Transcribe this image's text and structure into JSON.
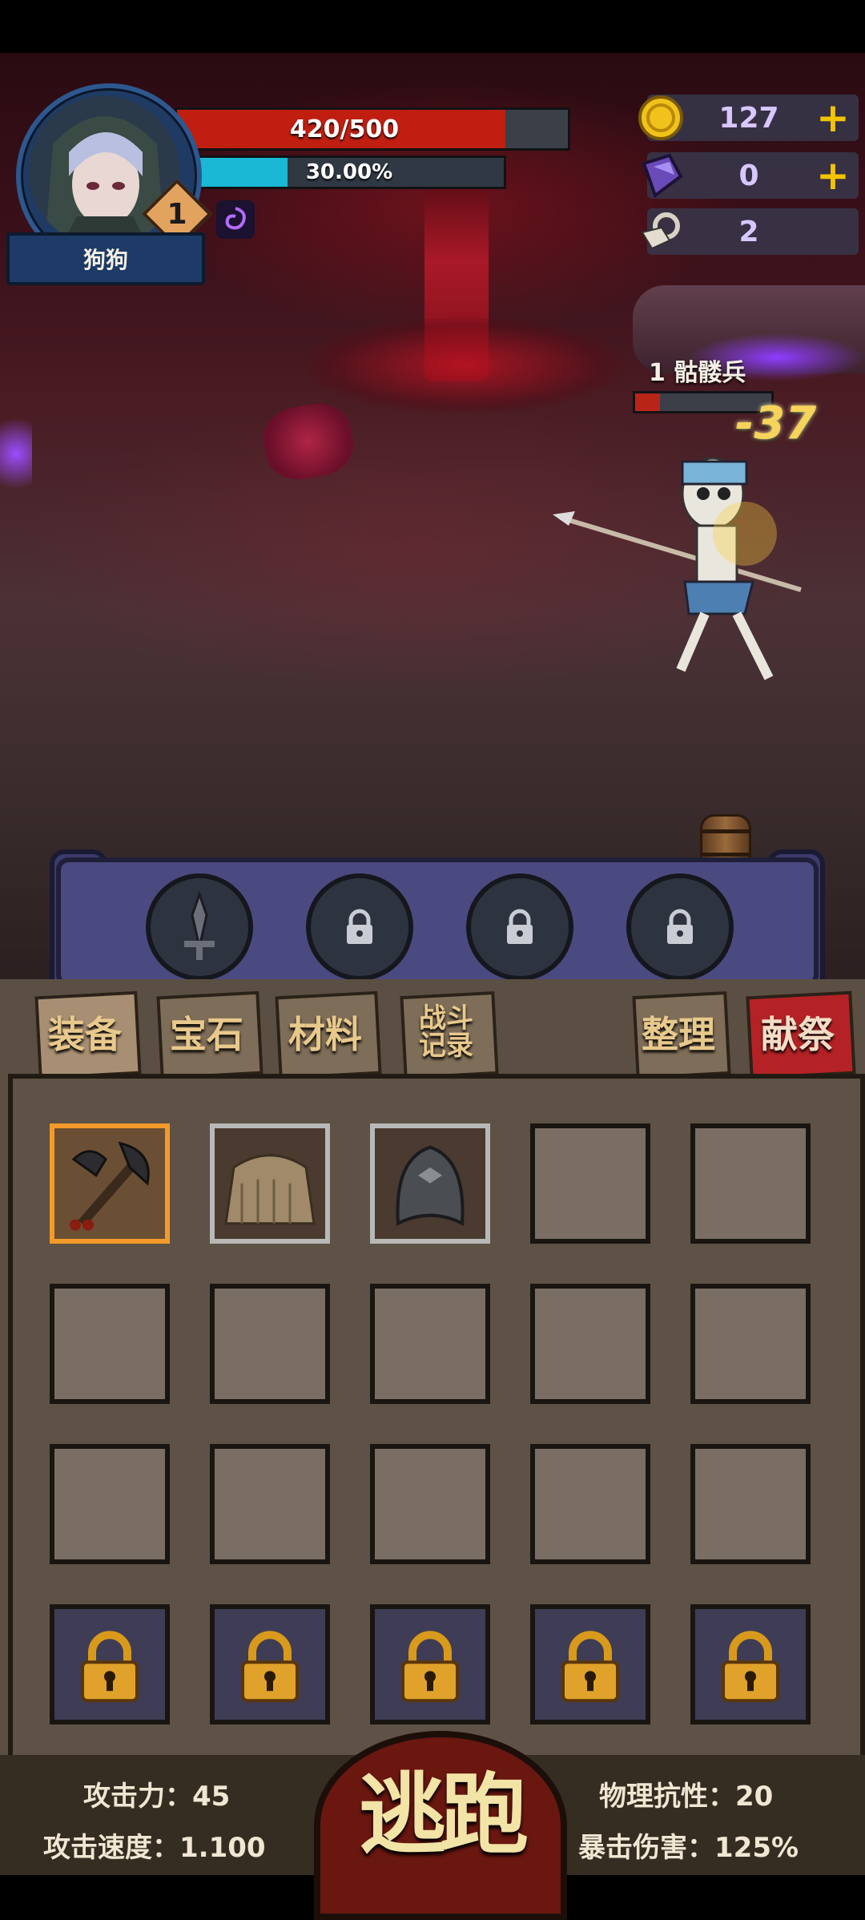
{
  "hero": {
    "name": "狗狗",
    "level": "1",
    "hp_text": "420/500",
    "hp_fraction": 0.84,
    "xp_text": "30.00%",
    "xp_fraction": 0.3
  },
  "resources": [
    {
      "icon": "gold-coin-icon",
      "value": "127",
      "has_plus": true
    },
    {
      "icon": "purple-crystal-icon",
      "value": "0",
      "has_plus": true
    },
    {
      "icon": "ram-skull-icon",
      "value": "2",
      "has_plus": false
    }
  ],
  "enemy": {
    "name": "1 骷髅兵",
    "hp_fraction": 0.18,
    "damage": "-37"
  },
  "skill_slots": [
    "sword-skill-icon",
    "lock-icon",
    "lock-icon",
    "lock-icon"
  ],
  "tabs": {
    "equipment": "装备",
    "gems": "宝石",
    "materials": "材料",
    "battle_log_line1": "战斗",
    "battle_log_line2": "记录",
    "sort": "整理",
    "sacrifice": "献祭"
  },
  "inventory": {
    "items": [
      "battle-axe-icon",
      "straw-cape-icon",
      "iron-helmet-icon"
    ]
  },
  "stats": {
    "attack": "攻击力：45",
    "attack_speed": "攻击速度：1.100",
    "phys_resist": "物理抗性：20",
    "crit_damage": "暴击伤害：125%"
  },
  "flee_label": "逃跑",
  "colors": {
    "hp": "#c01e10",
    "xp": "#1bb8d6",
    "gold": "#f2c400",
    "banner": "#4a4a80",
    "panel": "#5a4f42"
  }
}
